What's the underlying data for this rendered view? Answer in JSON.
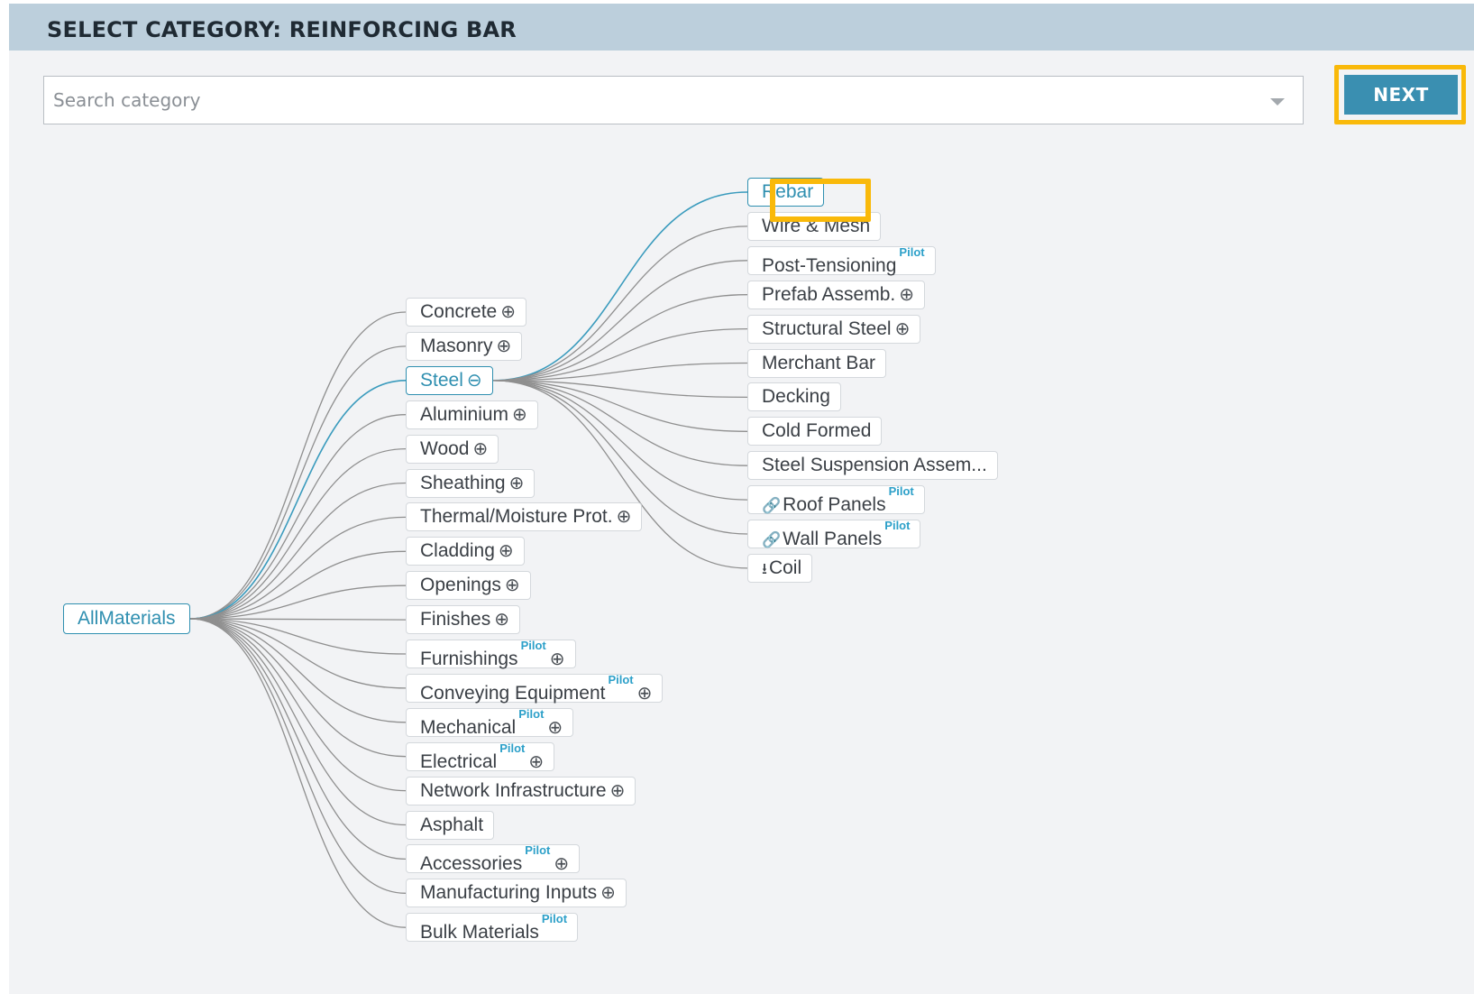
{
  "header": {
    "title": "SELECT CATEGORY: REINFORCING BAR"
  },
  "search": {
    "placeholder": "Search category",
    "value": ""
  },
  "next_button": {
    "label": "NEXT"
  },
  "colors": {
    "accent": "#2f8fb0",
    "highlight_outline": "#f9b90a",
    "header_bg": "#bccfdc",
    "button_bg": "#3a8fb1",
    "edge": "#8f8f8f",
    "active_edge": "#3a9bbd"
  },
  "tree": {
    "root": {
      "label": "AllMaterials",
      "active": true
    },
    "categories": [
      {
        "label": "Concrete",
        "expander": "⊕"
      },
      {
        "label": "Masonry",
        "expander": "⊕"
      },
      {
        "label": "Steel",
        "expander": "⊖",
        "active": true
      },
      {
        "label": "Aluminium",
        "expander": "⊕"
      },
      {
        "label": "Wood",
        "expander": "⊕"
      },
      {
        "label": "Sheathing",
        "expander": "⊕"
      },
      {
        "label": "Thermal/Moisture Prot.",
        "expander": "⊕"
      },
      {
        "label": "Cladding",
        "expander": "⊕"
      },
      {
        "label": "Openings",
        "expander": "⊕"
      },
      {
        "label": "Finishes",
        "expander": "⊕"
      },
      {
        "label": "Furnishings",
        "pilot": "Pilot",
        "expander": "⊕"
      },
      {
        "label": "Conveying Equipment",
        "pilot": "Pilot",
        "expander": "⊕"
      },
      {
        "label": "Mechanical",
        "pilot": "Pilot",
        "expander": "⊕"
      },
      {
        "label": "Electrical",
        "pilot": "Pilot",
        "expander": "⊕"
      },
      {
        "label": "Network Infrastructure",
        "expander": "⊕"
      },
      {
        "label": "Asphalt"
      },
      {
        "label": "Accessories",
        "pilot": "Pilot",
        "expander": "⊕"
      },
      {
        "label": "Manufacturing Inputs",
        "expander": "⊕"
      },
      {
        "label": "Bulk Materials",
        "pilot": "Pilot"
      }
    ],
    "steel_children": [
      {
        "label": "Rebar",
        "active": true,
        "selected": true
      },
      {
        "label": "Wire & Mesh"
      },
      {
        "label": "Post-Tensioning",
        "pilot": "Pilot"
      },
      {
        "label": "Prefab Assemb.",
        "expander": "⊕"
      },
      {
        "label": "Structural Steel",
        "expander": "⊕"
      },
      {
        "label": "Merchant Bar"
      },
      {
        "label": "Decking"
      },
      {
        "label": "Cold Formed"
      },
      {
        "label": "Steel Suspension Assem..."
      },
      {
        "label": "Roof Panels",
        "pilot": "Pilot",
        "icon": "link-icon",
        "icon_glyph": "🔗"
      },
      {
        "label": "Wall Panels",
        "pilot": "Pilot",
        "icon": "link-icon",
        "icon_glyph": "🔗"
      },
      {
        "label": "Coil",
        "icon": "download-icon",
        "icon_glyph": "⭳"
      }
    ]
  }
}
